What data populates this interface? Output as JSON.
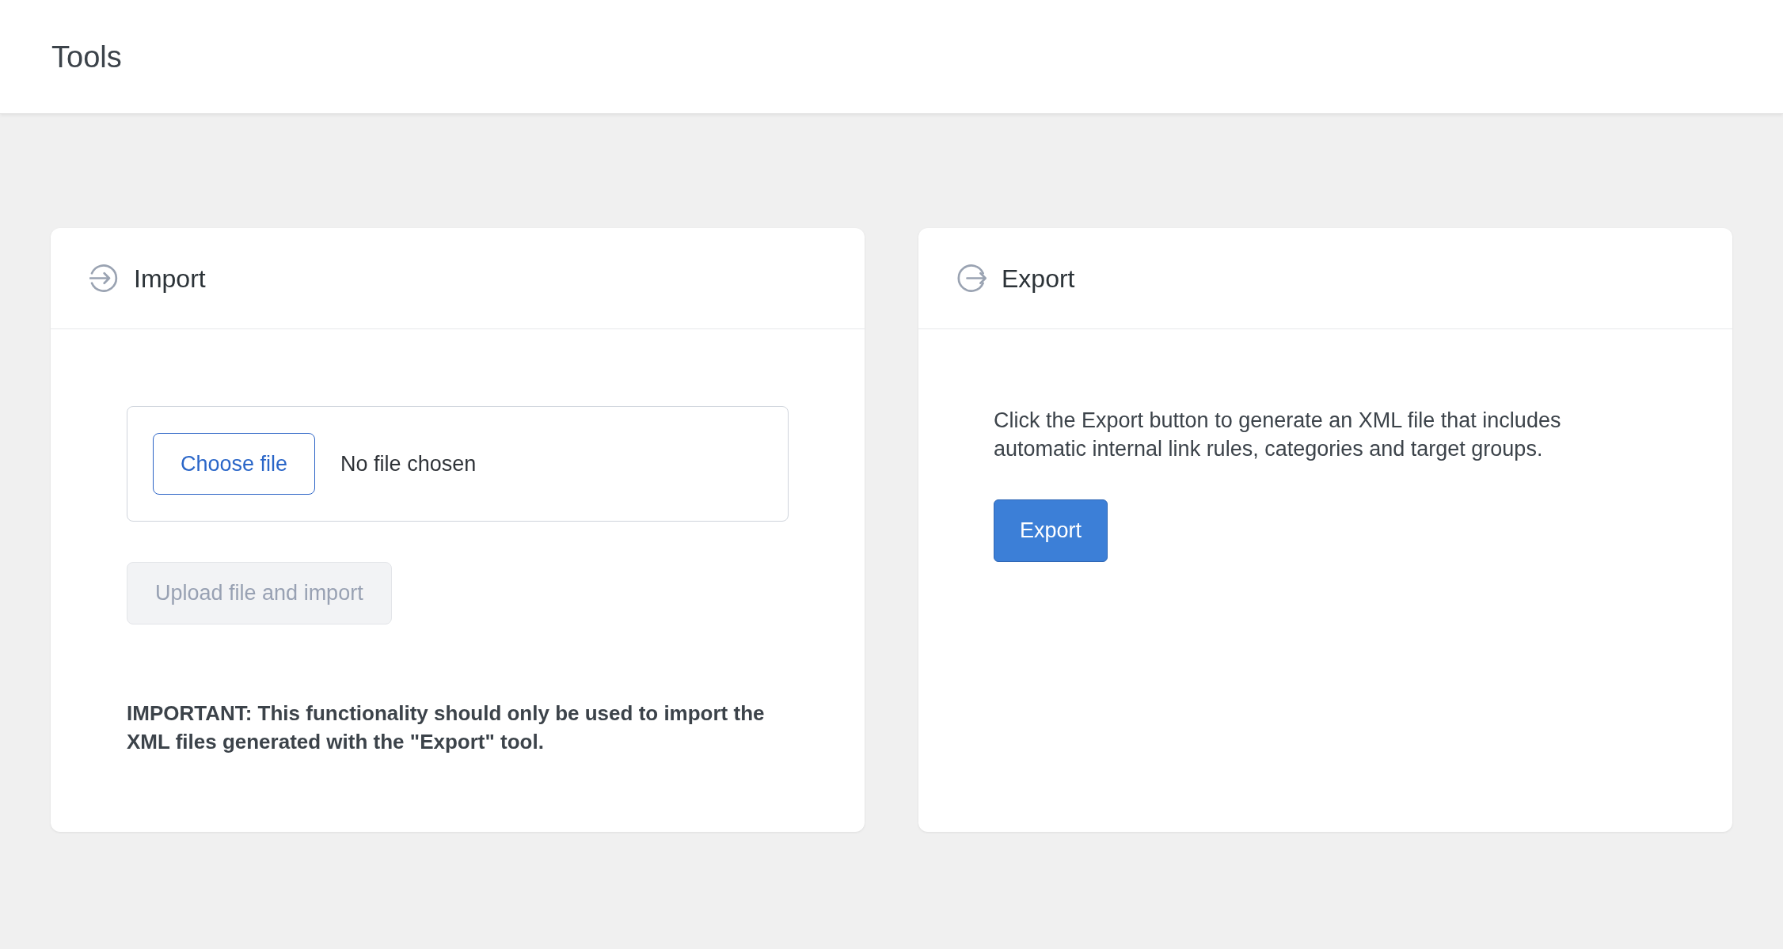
{
  "page": {
    "title": "Tools"
  },
  "cards": [
    {
      "kind": "import",
      "title": "Import",
      "file_input": {
        "button": "Choose file",
        "status": "No file chosen"
      },
      "upload_button": {
        "label": "Upload file and import",
        "disabled": true
      },
      "notice": "IMPORTANT: This functionality should only be used to import the XML files generated with the \"Export\" tool."
    },
    {
      "kind": "export",
      "title": "Export",
      "description": "Click the Export button to generate an XML file that includes automatic internal link rules, categories and target groups.",
      "button": {
        "label": "Export"
      }
    }
  ]
}
